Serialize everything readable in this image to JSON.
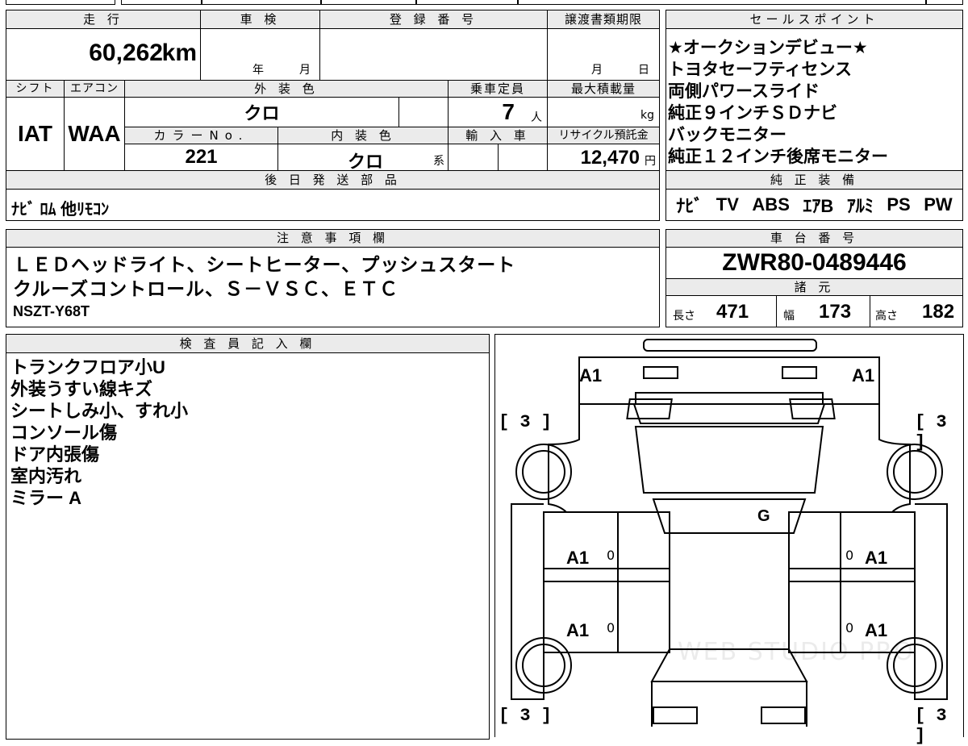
{
  "top_strip": [
    "",
    "",
    "",
    "",
    "",
    "",
    ""
  ],
  "mileage": {
    "header": "走 行",
    "value": "60,262",
    "unit": "km"
  },
  "inspection": {
    "header": "車 検",
    "year_label": "年",
    "month_label": "月"
  },
  "registration": {
    "header": "登 録 番 号",
    "value": ""
  },
  "transfer_deadline": {
    "header": "譲渡書類期限",
    "month_label": "月",
    "day_label": "日"
  },
  "sales_points": {
    "header": "セールスポイント",
    "items": [
      "★オークションデビュー★",
      "トヨタセーフティセンス",
      "両側パワースライド",
      "純正９インチＳＤナビ",
      "バックモニター",
      "純正１２インチ後席モニター"
    ]
  },
  "shift": {
    "header": "シフト",
    "value": "IAT"
  },
  "aircon": {
    "header": "エアコン",
    "value": "WAA"
  },
  "exterior_color": {
    "header": "外 装 色",
    "value": "クロ"
  },
  "capacity": {
    "header": "乗車定員",
    "value": "7",
    "unit": "人"
  },
  "max_load": {
    "header": "最大積載量",
    "unit": "kg"
  },
  "color_no": {
    "header": "カラーNo.",
    "value": "221"
  },
  "interior_color": {
    "header": "内 装 色",
    "value": "クロ",
    "suffix": "系"
  },
  "import": {
    "header": "輸 入 車"
  },
  "recycle": {
    "header": "リサイクル預託金",
    "value": "12,470",
    "unit": "円"
  },
  "later_parts": {
    "header": "後 日 発 送 部 品",
    "value": "ﾅﾋﾞ ﾛﾑ 他ﾘﾓｺﾝ"
  },
  "genuine_equipment": {
    "header": "純 正 装 備",
    "items": [
      "ﾅﾋﾞ",
      "TV",
      "ABS",
      "ｴｱB",
      "ｱﾙﾐ",
      "PS",
      "PW"
    ]
  },
  "notes": {
    "header": "注 意 事 項 欄",
    "lines": [
      "ＬＥＤヘッドライト、シートヒーター、プッシュスタート",
      "クルーズコントロール、Ｓ－ＶＳＣ、ＥＴＣ",
      "NSZT-Y68T"
    ]
  },
  "chassis": {
    "header": "車 台 番 号",
    "value": "ZWR80-0489446"
  },
  "specs": {
    "header": "諸 元",
    "length_label": "長さ",
    "length": "471",
    "width_label": "幅",
    "width": "173",
    "height_label": "高さ",
    "height": "182"
  },
  "inspector": {
    "header": "検 査 員 記 入 欄",
    "lines": [
      "トランクフロア小U",
      "外装うすい線キズ",
      "シートしみ小、すれ小",
      "コンソール傷",
      "ドア内張傷",
      "室内汚れ",
      "ミラー A"
    ]
  },
  "diagram": {
    "labels": {
      "rear_left": "A1",
      "rear_right": "A1",
      "glass": "G",
      "door_rl": "A1",
      "door_rr": "A1",
      "door_fl": "A1",
      "door_fr": "A1",
      "zero": "0",
      "tire": "3"
    },
    "watermark": "WEB STUDIO PRO"
  }
}
